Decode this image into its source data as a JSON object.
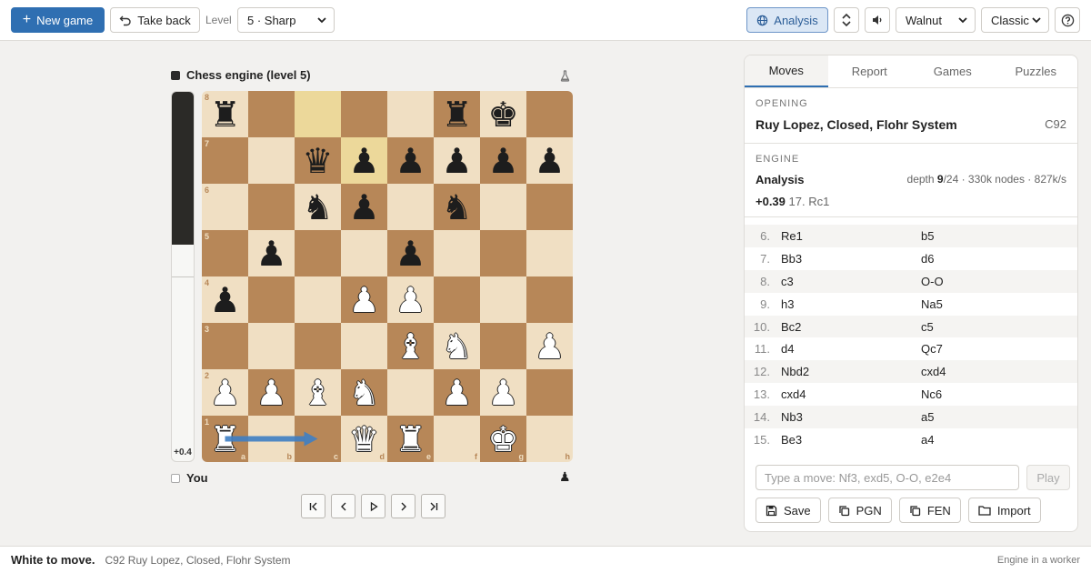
{
  "toolbar": {
    "new_game": "New game",
    "take_back": "Take back",
    "level_label": "Level",
    "level_value": "5 · Sharp",
    "analysis": "Analysis",
    "theme": "Walnut",
    "piece_set": "Classic"
  },
  "players": {
    "top": "Chess engine (level 5)",
    "bottom": "You"
  },
  "eval": {
    "label": "+0.4",
    "white_share": 0.53
  },
  "board": {
    "ranks": [
      "8",
      "7",
      "6",
      "5",
      "4",
      "3",
      "2",
      "1"
    ],
    "files": [
      "a",
      "b",
      "c",
      "d",
      "e",
      "f",
      "g",
      "h"
    ],
    "pieces": [
      [
        "r",
        "",
        "",
        "",
        "",
        "r",
        "k",
        ""
      ],
      [
        "",
        "",
        "q",
        "p",
        "p",
        "p",
        "p",
        "p"
      ],
      [
        "",
        "",
        "n",
        "p",
        "",
        "n",
        "",
        ""
      ],
      [
        "",
        "p",
        "",
        "",
        "p",
        "",
        "",
        ""
      ],
      [
        "p",
        "",
        "",
        "P",
        "P",
        "",
        "",
        ""
      ],
      [
        "",
        "",
        "",
        "",
        "B",
        "N",
        "",
        "P"
      ],
      [
        "P",
        "P",
        "B",
        "N",
        "",
        "P",
        "P",
        ""
      ],
      [
        "R",
        "",
        "",
        "Q",
        "R",
        "",
        "K",
        ""
      ]
    ],
    "highlights": [
      "c8",
      "d7"
    ],
    "arrow": {
      "from": "a1",
      "to": "c1",
      "color": "#3f7fc4"
    }
  },
  "panel": {
    "tabs": [
      "Moves",
      "Report",
      "Games",
      "Puzzles"
    ],
    "opening_title": "Opening",
    "opening_name": "Ruy Lopez, Closed, Flohr System",
    "eco": "C92",
    "engine_title": "Engine",
    "engine_name": "Analysis",
    "depth_prefix": "depth ",
    "depth": "9",
    "depth_rest": "/24 · 330k nodes · 827k/s",
    "eval_score": "+0.39",
    "eval_line": " 17. Rc1",
    "moves": [
      {
        "n": "6.",
        "w": "Re1",
        "b": "b5"
      },
      {
        "n": "7.",
        "w": "Bb3",
        "b": "d6"
      },
      {
        "n": "8.",
        "w": "c3",
        "b": "O-O"
      },
      {
        "n": "9.",
        "w": "h3",
        "b": "Na5"
      },
      {
        "n": "10.",
        "w": "Bc2",
        "b": "c5"
      },
      {
        "n": "11.",
        "w": "d4",
        "b": "Qc7"
      },
      {
        "n": "12.",
        "w": "Nbd2",
        "b": "cxd4"
      },
      {
        "n": "13.",
        "w": "cxd4",
        "b": "Nc6"
      },
      {
        "n": "14.",
        "w": "Nb3",
        "b": "a5"
      },
      {
        "n": "15.",
        "w": "Be3",
        "b": "a4"
      }
    ],
    "move_placeholder": "Type a move: Nf3, exd5, O-O, e2e4",
    "play": "Play",
    "save": "Save",
    "pgn": "PGN",
    "fen": "FEN",
    "import": "Import"
  },
  "status": {
    "main": "White to move.",
    "sub": "C92 Ruy Lopez, Closed, Flohr System",
    "right": "Engine in a worker"
  }
}
